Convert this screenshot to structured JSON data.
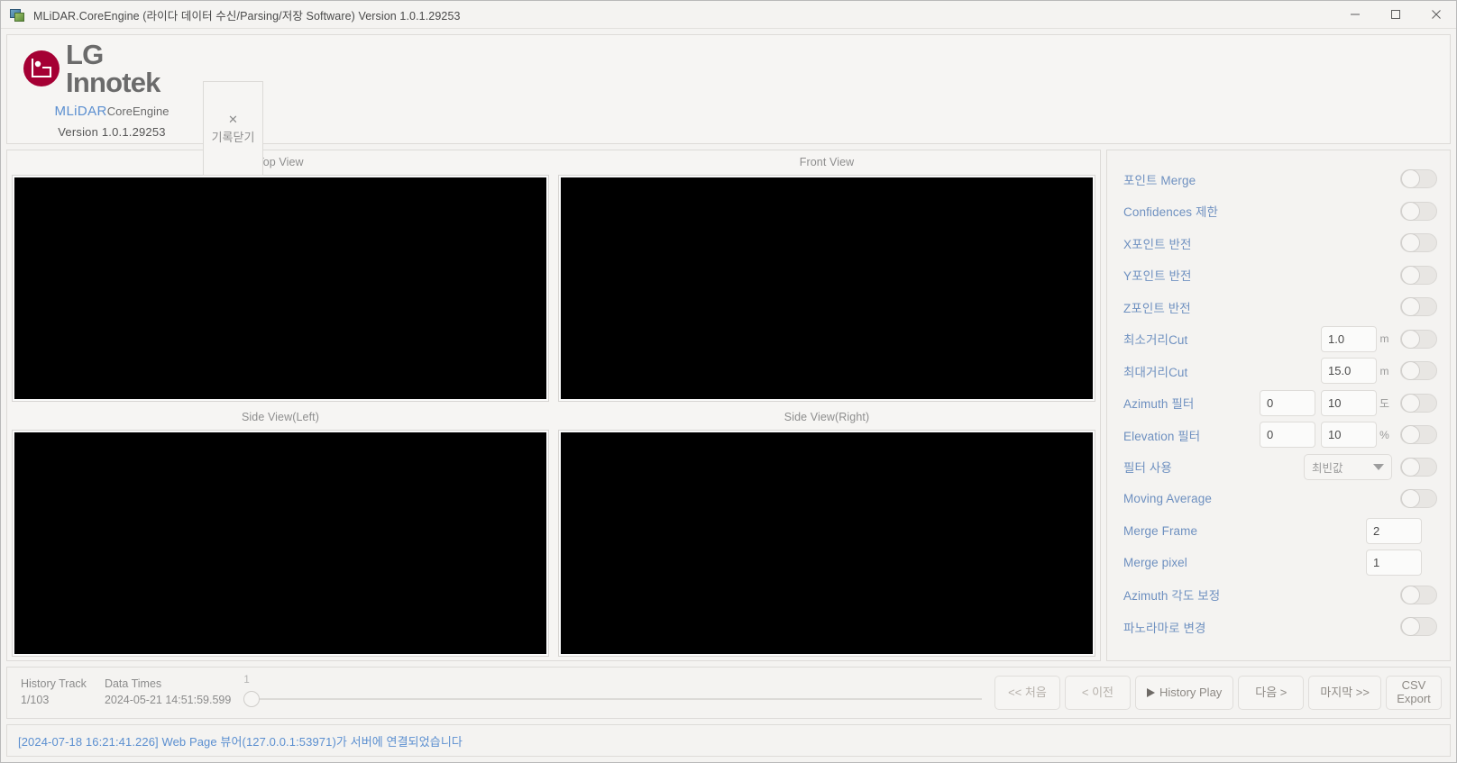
{
  "window": {
    "title": "MLiDAR.CoreEngine (라이다 데이터 수신/Parsing/저장 Software) Version 1.0.1.29253",
    "app_icon": "app-window-icon",
    "minimize_icon": "minimize-icon",
    "maximize_icon": "maximize-icon",
    "close_icon": "close-icon"
  },
  "header": {
    "brand_name": "LG Innotek",
    "product_primary": "MLiDAR",
    "product_secondary": "CoreEngine",
    "version_label": "Version",
    "version_value": "1.0.1.29253",
    "close_record_x": "✕",
    "close_record_label": "기록닫기"
  },
  "views": [
    {
      "title": "Top View",
      "canvas": "point-cloud-canvas-top"
    },
    {
      "title": "Front View",
      "canvas": "point-cloud-canvas-front"
    },
    {
      "title": "Side View(Left)",
      "canvas": "point-cloud-canvas-side-left"
    },
    {
      "title": "Side View(Right)",
      "canvas": "point-cloud-canvas-side-right"
    }
  ],
  "settings": {
    "rows": [
      {
        "label": "포인트 Merge",
        "kind": "toggle",
        "toggle": "off"
      },
      {
        "label": "Confidences 제한",
        "kind": "toggle",
        "toggle": "off"
      },
      {
        "label": "X포인트 반전",
        "kind": "toggle",
        "toggle": "off"
      },
      {
        "label": "Y포인트 반전",
        "kind": "toggle",
        "toggle": "off"
      },
      {
        "label": "Z포인트 반전",
        "kind": "toggle",
        "toggle": "off"
      },
      {
        "label": "최소거리Cut",
        "kind": "one_input_unit_toggle",
        "value1": "1.0",
        "unit": "m",
        "toggle": "off"
      },
      {
        "label": "최대거리Cut",
        "kind": "one_input_unit_toggle",
        "value1": "15.0",
        "unit": "m",
        "toggle": "off"
      },
      {
        "label": "Azimuth 필터",
        "kind": "two_input_unit_toggle",
        "value1": "0",
        "value2": "10",
        "unit": "도",
        "toggle": "off"
      },
      {
        "label": "Elevation 필터",
        "kind": "two_input_unit_toggle",
        "value1": "0",
        "value2": "10",
        "unit": "%",
        "toggle": "off"
      },
      {
        "label": "필터 사용",
        "kind": "select_toggle",
        "selected": "최빈값",
        "toggle": "off"
      },
      {
        "label": "Moving Average",
        "kind": "toggle",
        "toggle": "off"
      },
      {
        "label": "Merge Frame",
        "kind": "input_only",
        "value1": "2"
      },
      {
        "label": "Merge pixel",
        "kind": "input_only",
        "value1": "1"
      },
      {
        "label": "Azimuth 각도 보정",
        "kind": "toggle",
        "toggle": "off"
      },
      {
        "label": "파노라마로 변경",
        "kind": "toggle",
        "toggle": "off"
      }
    ],
    "filter_options": [
      "최빈값"
    ],
    "label_color": "#6e90c0"
  },
  "transport": {
    "history_track_label": "History Track",
    "history_track_value": "1/103",
    "data_times_label": "Data Times",
    "data_times_value": "2024-05-21 14:51:59.599",
    "slider_tick": "1",
    "slider_position_percent": 0,
    "buttons": [
      {
        "label": "<< 처음",
        "name": "first-button",
        "enabled": false,
        "icon": ""
      },
      {
        "label": "< 이전",
        "name": "previous-button",
        "enabled": false,
        "icon": ""
      },
      {
        "label": "History Play",
        "name": "history-play-button",
        "enabled": true,
        "icon": "play-icon"
      },
      {
        "label": "다음 >",
        "name": "next-button",
        "enabled": true,
        "icon": ""
      },
      {
        "label": "마지막 >>",
        "name": "last-button",
        "enabled": true,
        "icon": ""
      }
    ],
    "csv_button_line1": "CSV",
    "csv_button_line2": "Export"
  },
  "status": {
    "message": "[2024-07-18 16:21:41.226] Web Page 뷰어(127.0.0.1:53971)가 서버에 연결되었습니다",
    "color": "#5b8fd0"
  }
}
